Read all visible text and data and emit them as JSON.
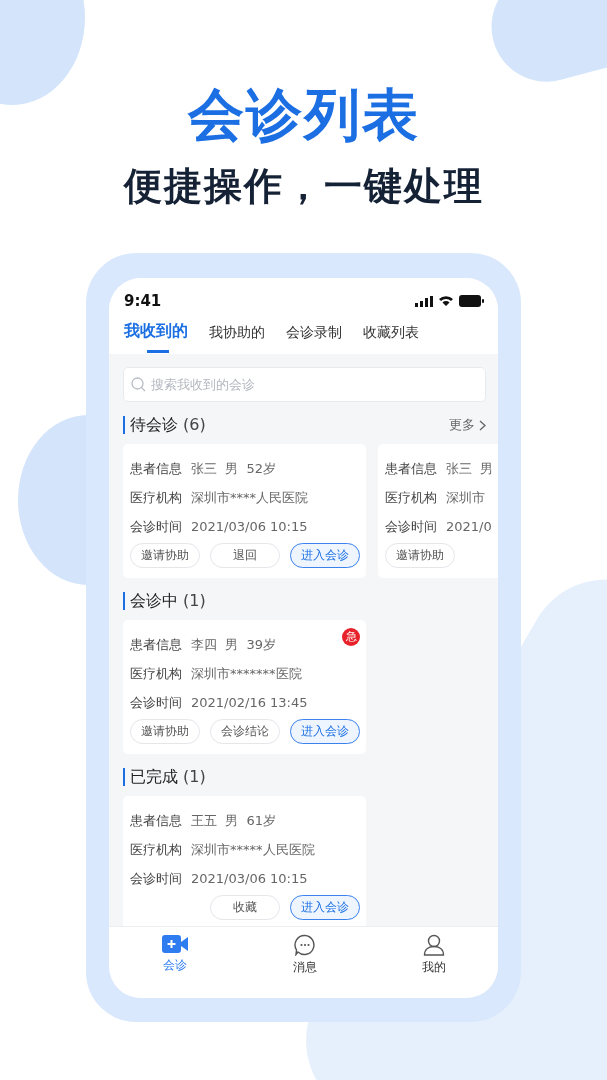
{
  "headline": "会诊列表",
  "subheadline": "便捷操作，一键处理",
  "status_bar": {
    "time": "9:41"
  },
  "tabs": [
    {
      "label": "我收到的",
      "selected": true
    },
    {
      "label": "我协助的",
      "selected": false
    },
    {
      "label": "会诊录制",
      "selected": false
    },
    {
      "label": "收藏列表",
      "selected": false
    }
  ],
  "search": {
    "placeholder": "搜索我收到的会诊"
  },
  "sections": [
    {
      "title": "待会诊",
      "count": "(6)",
      "more": "更多",
      "cards": [
        {
          "urgent": false,
          "truncated": false,
          "rows": [
            {
              "label": "患者信息",
              "value": "张三  男  52岁"
            },
            {
              "label": "医疗机构",
              "value": "深圳市****人民医院"
            },
            {
              "label": "会诊时间",
              "value": "2021/03/06 10:15"
            }
          ],
          "buttons": [
            {
              "label": "邀请协助",
              "kind": "normal"
            },
            {
              "label": "退回",
              "kind": "normal"
            },
            {
              "label": "进入会诊",
              "kind": "primary"
            }
          ]
        },
        {
          "urgent": false,
          "truncated": true,
          "rows": [
            {
              "label": "患者信息",
              "value": "张三  男"
            },
            {
              "label": "医疗机构",
              "value": "深圳市"
            },
            {
              "label": "会诊时间",
              "value": "2021/0"
            }
          ],
          "buttons": [
            {
              "label": "邀请协助",
              "kind": "normal"
            }
          ]
        }
      ]
    },
    {
      "title": "会诊中",
      "count": "(1)",
      "cards": [
        {
          "urgent": true,
          "badge": "急",
          "truncated": false,
          "rows": [
            {
              "label": "患者信息",
              "value": "李四  男  39岁"
            },
            {
              "label": "医疗机构",
              "value": "深圳市*******医院"
            },
            {
              "label": "会诊时间",
              "value": "2021/02/16 13:45"
            }
          ],
          "buttons": [
            {
              "label": "邀请协助",
              "kind": "normal"
            },
            {
              "label": "会诊结论",
              "kind": "normal"
            },
            {
              "label": "进入会诊",
              "kind": "primary"
            }
          ]
        }
      ]
    },
    {
      "title": "已完成",
      "count": "(1)",
      "cards": [
        {
          "urgent": false,
          "truncated": false,
          "rows": [
            {
              "label": "患者信息",
              "value": "王五  男  61岁"
            },
            {
              "label": "医疗机构",
              "value": "深圳市*****人民医院"
            },
            {
              "label": "会诊时间",
              "value": "2021/03/06 10:15"
            }
          ],
          "buttons": [
            {
              "label": "收藏",
              "kind": "normal"
            },
            {
              "label": "进入会诊",
              "kind": "primary"
            }
          ]
        }
      ]
    }
  ],
  "bottom_nav": [
    {
      "label": "会诊",
      "selected": true
    },
    {
      "label": "消息",
      "selected": false
    },
    {
      "label": "我的",
      "selected": false
    }
  ]
}
